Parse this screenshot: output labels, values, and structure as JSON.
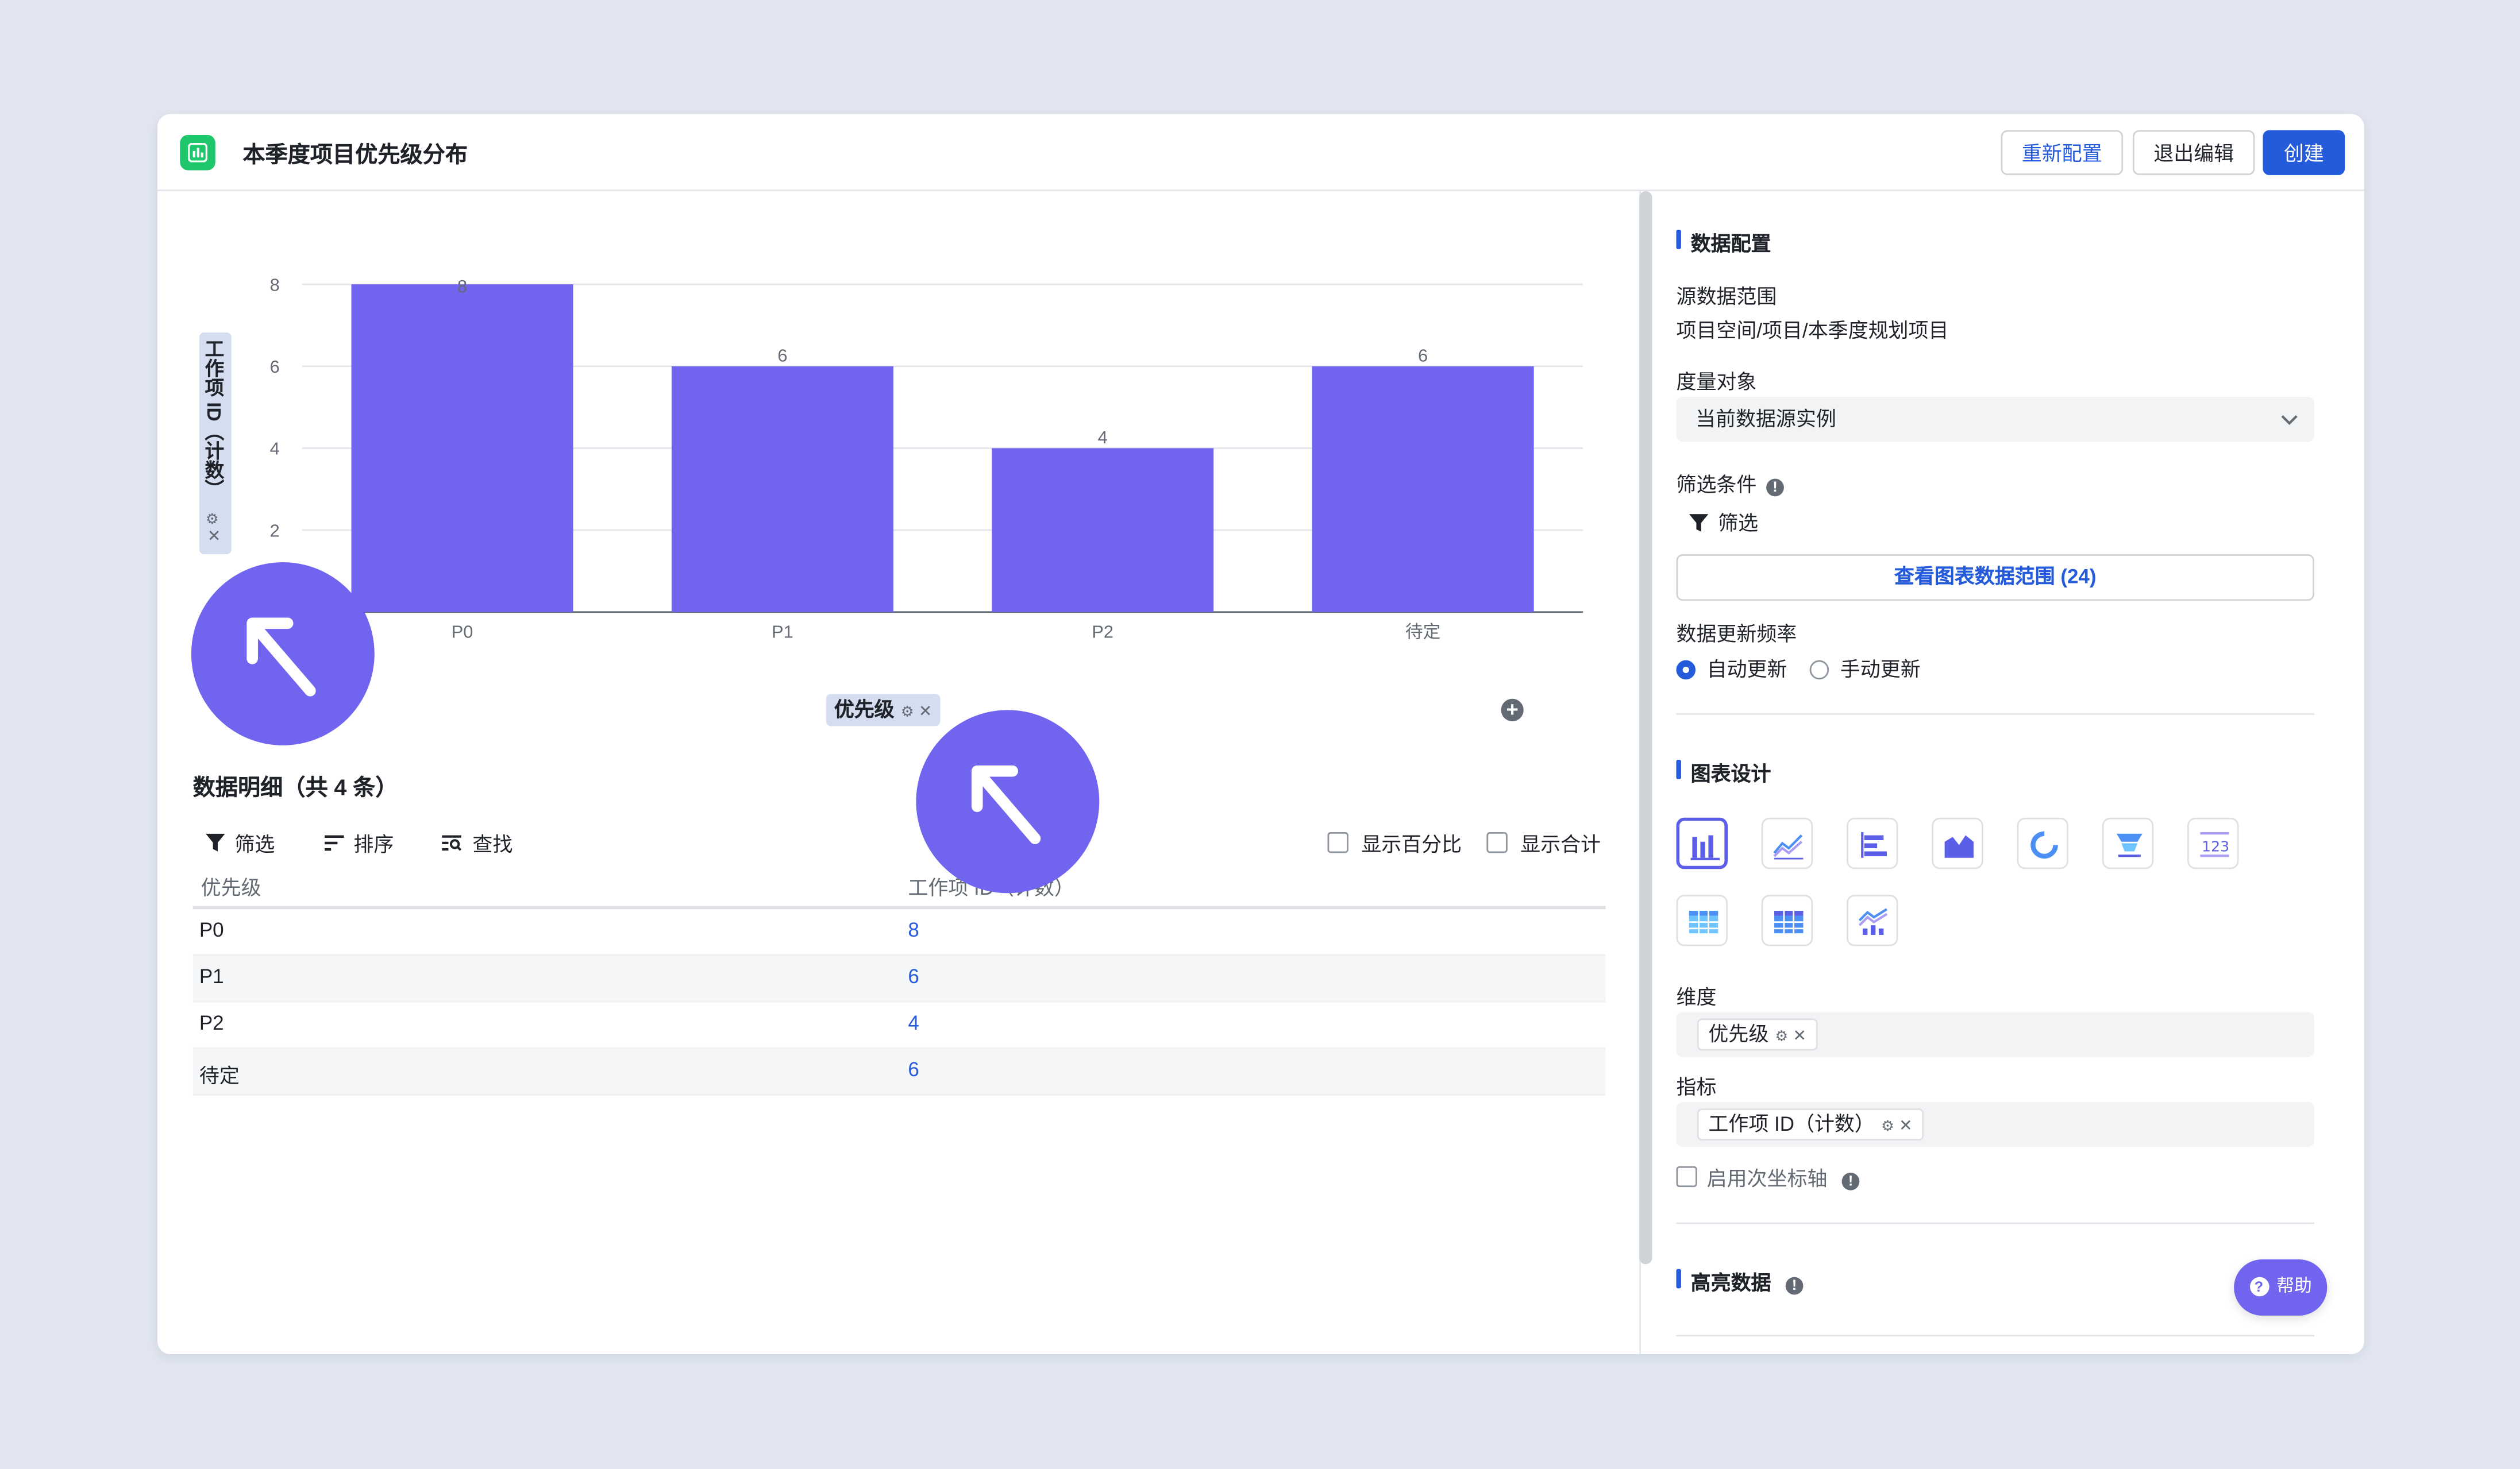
{
  "header": {
    "title": "本季度项目优先级分布",
    "reconfigure_label": "重新配置",
    "exit_edit_label": "退出编辑",
    "create_label": "创建"
  },
  "chart_data": {
    "type": "bar",
    "categories": [
      "P0",
      "P1",
      "P2",
      "待定"
    ],
    "values": [
      8,
      6,
      4,
      6
    ],
    "ylabel": "工作项 ID（计数）",
    "xlabel": "优先级",
    "yticks": [
      2,
      4,
      6,
      8
    ],
    "ylim": [
      0,
      8
    ],
    "grid": true,
    "bar_color": "#7165f0"
  },
  "detail": {
    "title": "数据明细（共 4 条）",
    "filter_label": "筛选",
    "sort_label": "排序",
    "find_label": "查找",
    "show_percent_label": "显示百分比",
    "show_total_label": "显示合计",
    "columns": [
      "优先级",
      "工作项 ID（计数）"
    ],
    "rows": [
      {
        "priority": "P0",
        "count": "8"
      },
      {
        "priority": "P1",
        "count": "6"
      },
      {
        "priority": "P2",
        "count": "4"
      },
      {
        "priority": "待定",
        "count": "6"
      }
    ]
  },
  "panel": {
    "data_config_title": "数据配置",
    "source_range_label": "源数据范围",
    "source_range_value": "项目空间/项目/本季度规划项目",
    "measure_object_label": "度量对象",
    "measure_object_value": "当前数据源实例",
    "filter_condition_label": "筛选条件",
    "filter_label": "筛选",
    "view_range_label": "查看图表数据范围 (24)",
    "update_freq_label": "数据更新频率",
    "auto_update_label": "自动更新",
    "manual_update_label": "手动更新",
    "chart_design_title": "图表设计",
    "dimension_label": "维度",
    "dimension_tag": "优先级",
    "metric_label": "指标",
    "metric_tag": "工作项 ID（计数）",
    "secondary_axis_label": "启用次坐标轴",
    "highlight_title": "高亮数据",
    "help_label": "帮助"
  },
  "colors": {
    "accent": "#245bdb",
    "bar": "#7165f0",
    "app_icon": "#1ec76b"
  }
}
